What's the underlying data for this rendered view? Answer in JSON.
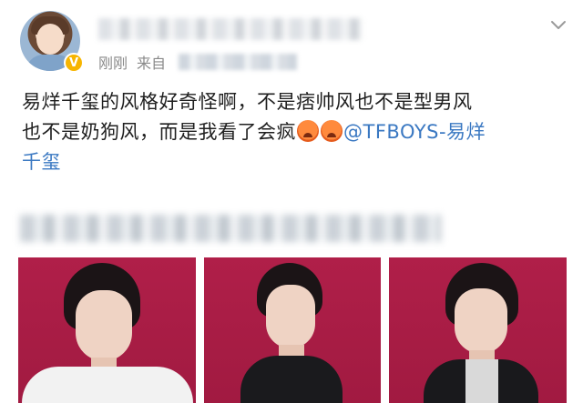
{
  "header": {
    "time_label": "刚刚",
    "source_label": "来自",
    "verified_badge": "V",
    "avatar_icon": "avatar-icon",
    "menu_icon": "chevron-down-icon"
  },
  "post": {
    "text_line1": "易烊千玺的风格好奇怪啊，不是痞帅风也不是型男风",
    "text_line2_start": "也不是奶狗风，而是我看了会疯",
    "emoji_name": "hot-face-emoji",
    "mention": "@TFBOYS-易烊",
    "text_line3": "千玺"
  },
  "colors": {
    "mention": "#3a78c2",
    "photo_bg": "#aa1d45",
    "badge": "#f7b500"
  },
  "photos": [
    {
      "label": "photo-1"
    },
    {
      "label": "photo-2"
    },
    {
      "label": "photo-3"
    }
  ]
}
